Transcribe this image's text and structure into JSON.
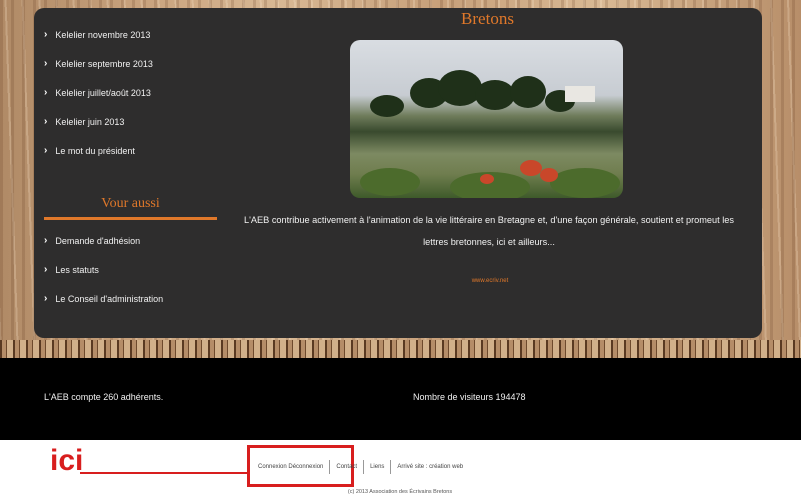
{
  "sidebar": {
    "items": [
      {
        "label": "Kelelier novembre 2013"
      },
      {
        "label": "Kelelier septembre 2013"
      },
      {
        "label": "Kelelier juillet/août 2013"
      },
      {
        "label": "Kelelier juin 2013"
      },
      {
        "label": "Le mot du président"
      }
    ],
    "section_heading": "Vour aussi",
    "items2": [
      {
        "label": "Demande d'adhésion"
      },
      {
        "label": "Les statuts"
      },
      {
        "label": "Le Conseil d'administration"
      }
    ]
  },
  "main": {
    "title": "Bretons",
    "description": "L'AEB contribue activement à l'animation de la vie littéraire en Bretagne et, d'une façon générale, soutient et promeut les lettres bretonnes, ici et ailleurs...",
    "link": "www.ecriv.net"
  },
  "footer": {
    "members": "L'AEB compte 260 adhérents.",
    "visitors": "Nombre de visiteurs 194478"
  },
  "annotation": {
    "label": "ici"
  },
  "bottom_nav": {
    "links": [
      {
        "label": "Connexion Déconnexion"
      },
      {
        "label": "Contact"
      },
      {
        "label": "Liens"
      },
      {
        "label": "Arrivé site : création web"
      }
    ],
    "copyright": "(c) 2013 Association des Écrivains Bretons"
  },
  "colors": {
    "accent": "#e0782a",
    "panel": "#2e2d2d",
    "footer": "#000000",
    "highlight": "#d81e1e"
  }
}
